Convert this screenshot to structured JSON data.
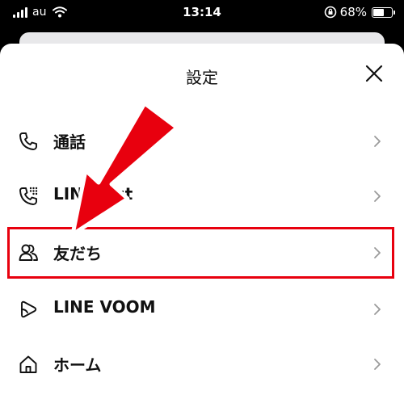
{
  "status_bar": {
    "carrier": "au",
    "time": "13:14",
    "battery_percent": "68%",
    "battery_level": 0.68
  },
  "sheet": {
    "title": "設定"
  },
  "menu": {
    "items": [
      {
        "label": "通話",
        "icon": "phone-icon"
      },
      {
        "label": "LINE Out",
        "icon": "phone-dial-icon"
      },
      {
        "label": "友だち",
        "icon": "friends-icon"
      },
      {
        "label": "LINE VOOM",
        "icon": "voom-icon"
      },
      {
        "label": "ホーム",
        "icon": "home-icon"
      }
    ]
  },
  "annotation": {
    "highlight_color": "#e8000e",
    "arrow_color": "#e8000e"
  }
}
